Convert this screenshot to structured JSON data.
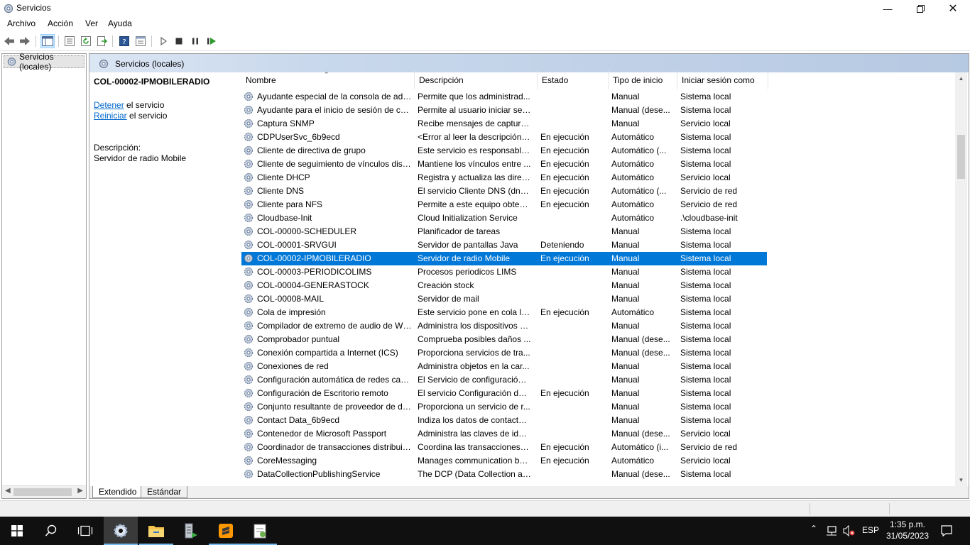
{
  "window": {
    "title": "Servicios"
  },
  "menu": [
    "Archivo",
    "Acción",
    "Ver",
    "Ayuda"
  ],
  "toolbar": {
    "buttons": [
      "back-icon",
      "forward-icon",
      "show-hide-console-tree-icon",
      "export-list-icon",
      "refresh-icon",
      "export-icon",
      "help-icon",
      "properties-icon",
      "start-service-icon",
      "stop-service-icon",
      "pause-service-icon",
      "resume-service-icon"
    ]
  },
  "tree": {
    "root_label": "Servicios (locales)"
  },
  "panel": {
    "header_title": "Servicios (locales)",
    "selected_service": "COL-00002-IPMOBILERADIO",
    "action_stop_link": "Detener",
    "action_stop_suffix": " el servicio",
    "action_restart_link": "Reiniciar",
    "action_restart_suffix": " el servicio",
    "description_label": "Descripción:",
    "description_text": "Servidor de radio Mobile"
  },
  "columns": [
    "Nombre",
    "Descripción",
    "Estado",
    "Tipo de inicio",
    "Iniciar sesión como"
  ],
  "rows": [
    [
      "Ayudante especial de la consola de adm...",
      "Permite que los administrad...",
      "",
      "Manual",
      "Sistema local"
    ],
    [
      "Ayudante para el inicio de sesión de cue...",
      "Permite al usuario iniciar sesi...",
      "",
      "Manual (dese...",
      "Sistema local"
    ],
    [
      "Captura SNMP",
      "Recibe mensajes de captura ...",
      "",
      "Manual",
      "Servicio local"
    ],
    [
      "CDPUserSvc_6b9ecd",
      "<Error al leer la descripción. ...",
      "En ejecución",
      "Automático",
      "Sistema local"
    ],
    [
      "Cliente de directiva de grupo",
      "Este servicio es responsable ...",
      "En ejecución",
      "Automático (...",
      "Sistema local"
    ],
    [
      "Cliente de seguimiento de vínculos distr...",
      "Mantiene los vínculos entre ...",
      "En ejecución",
      "Automático",
      "Sistema local"
    ],
    [
      "Cliente DHCP",
      "Registra y actualiza las direcc...",
      "En ejecución",
      "Automático",
      "Servicio local"
    ],
    [
      "Cliente DNS",
      "El servicio Cliente DNS (dnsc...",
      "En ejecución",
      "Automático (...",
      "Servicio de red"
    ],
    [
      "Cliente para NFS",
      "Permite a este equipo obten...",
      "En ejecución",
      "Automático",
      "Servicio de red"
    ],
    [
      "Cloudbase-Init",
      "Cloud Initialization Service",
      "",
      "Automático",
      ".\\cloudbase-init"
    ],
    [
      "COL-00000-SCHEDULER",
      "Planificador de tareas",
      "",
      "Manual",
      "Sistema local"
    ],
    [
      "COL-00001-SRVGUI",
      "Servidor de pantallas Java",
      "Deteniendo",
      "Manual",
      "Sistema local"
    ],
    [
      "COL-00002-IPMOBILERADIO",
      "Servidor de radio Mobile",
      "En ejecución",
      "Manual",
      "Sistema local"
    ],
    [
      "COL-00003-PERIODICOLIMS",
      "Procesos periodicos LIMS",
      "",
      "Manual",
      "Sistema local"
    ],
    [
      "COL-00004-GENERASTOCK",
      "Creación stock",
      "",
      "Manual",
      "Sistema local"
    ],
    [
      "COL-00008-MAIL",
      "Servidor de mail",
      "",
      "Manual",
      "Sistema local"
    ],
    [
      "Cola de impresión",
      "Este servicio pone en cola lo...",
      "En ejecución",
      "Automático",
      "Sistema local"
    ],
    [
      "Compilador de extremo de audio de Wi...",
      "Administra los dispositivos d...",
      "",
      "Manual",
      "Sistema local"
    ],
    [
      "Comprobador puntual",
      "Comprueba posibles daños ...",
      "",
      "Manual (dese...",
      "Sistema local"
    ],
    [
      "Conexión compartida a Internet (ICS)",
      "Proporciona servicios de tra...",
      "",
      "Manual (dese...",
      "Sistema local"
    ],
    [
      "Conexiones de red",
      "Administra objetos en la car...",
      "",
      "Manual",
      "Sistema local"
    ],
    [
      "Configuración automática de redes cabl...",
      "El Servicio de configuración ...",
      "",
      "Manual",
      "Sistema local"
    ],
    [
      "Configuración de Escritorio remoto",
      "El servicio Configuración de ...",
      "En ejecución",
      "Manual",
      "Sistema local"
    ],
    [
      "Conjunto resultante de proveedor de dir...",
      "Proporciona un servicio de r...",
      "",
      "Manual",
      "Sistema local"
    ],
    [
      "Contact Data_6b9ecd",
      "Indiza los datos de contacto ...",
      "",
      "Manual",
      "Sistema local"
    ],
    [
      "Contenedor de Microsoft Passport",
      "Administra las claves de iden...",
      "",
      "Manual (dese...",
      "Servicio local"
    ],
    [
      "Coordinador de transacciones distribuid...",
      "Coordina las transacciones q...",
      "En ejecución",
      "Automático (i...",
      "Servicio de red"
    ],
    [
      "CoreMessaging",
      "Manages communication be...",
      "En ejecución",
      "Automático",
      "Servicio local"
    ],
    [
      "DataCollectionPublishingService",
      "The DCP (Data Collection an...",
      "",
      "Manual (dese...",
      "Sistema local"
    ]
  ],
  "selected_row_index": 12,
  "tabs": [
    "Extendido",
    "Estándar"
  ],
  "taskbar": {
    "language": "ESP",
    "time": "1:35 p.m.",
    "date": "31/05/2023"
  },
  "colors": {
    "selection": "#0078d7",
    "link": "#0066cc",
    "taskbar": "#101010"
  }
}
